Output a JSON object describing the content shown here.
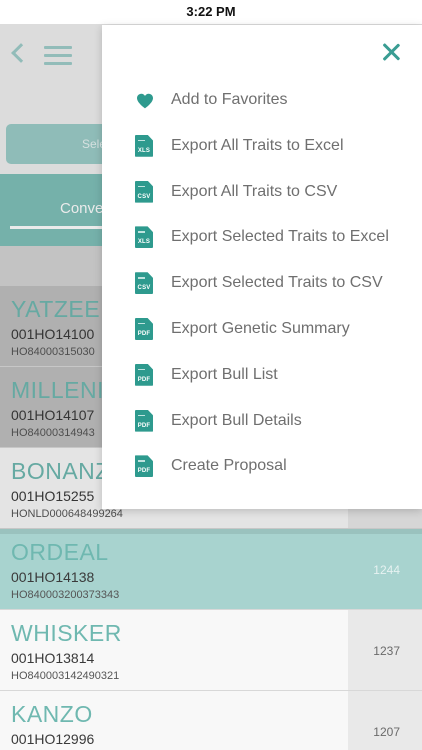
{
  "status_bar": {
    "time": "3:22 PM"
  },
  "background": {
    "select_button_label": "Sele",
    "tab_label": "Conve",
    "rows": [
      {
        "name": "YATZEE",
        "code": "001HO14100",
        "reg": "HO84000315030",
        "score": "",
        "style": "dim"
      },
      {
        "name": "MILLENI",
        "code": "001HO14107",
        "reg": "HO84000314943",
        "score": "",
        "style": "dim"
      },
      {
        "name": "BONANZ",
        "code": "001HO15255",
        "reg": "HONLD000648499264",
        "score": "",
        "style": "white"
      },
      {
        "name": "ORDEAL",
        "code": "001HO14138",
        "reg": "HO840003200373343",
        "score": "1244",
        "style": "teal"
      },
      {
        "name": "WHISKER",
        "code": "001HO13814",
        "reg": "HO840003142490321",
        "score": "1237",
        "style": "white"
      },
      {
        "name": "KANZO",
        "code": "001HO12996",
        "reg": "",
        "score": "1207",
        "style": "white"
      }
    ]
  },
  "popup": {
    "close_icon": "close-icon",
    "items": [
      {
        "label": "Add to Favorites",
        "icon": "heart-icon",
        "file_type": ""
      },
      {
        "label": "Export All Traits to Excel",
        "icon": "xls-file-icon",
        "file_type": "XLS"
      },
      {
        "label": "Export All Traits to CSV",
        "icon": "csv-file-icon",
        "file_type": "CSV"
      },
      {
        "label": "Export Selected Traits to Excel",
        "icon": "xls-file-icon",
        "file_type": "XLS"
      },
      {
        "label": "Export Selected Traits to CSV",
        "icon": "csv-file-icon",
        "file_type": "CSV"
      },
      {
        "label": "Export Genetic Summary",
        "icon": "pdf-file-icon",
        "file_type": "PDF"
      },
      {
        "label": "Export Bull List",
        "icon": "pdf-file-icon",
        "file_type": "PDF"
      },
      {
        "label": "Export Bull Details",
        "icon": "pdf-file-icon",
        "file_type": "PDF"
      },
      {
        "label": "Create Proposal",
        "icon": "pdf-file-icon",
        "file_type": "PDF"
      }
    ]
  },
  "colors": {
    "accent": "#2e9a8e",
    "teal_row": "#a8d3cf",
    "tab_band": "#7fc0b9"
  }
}
